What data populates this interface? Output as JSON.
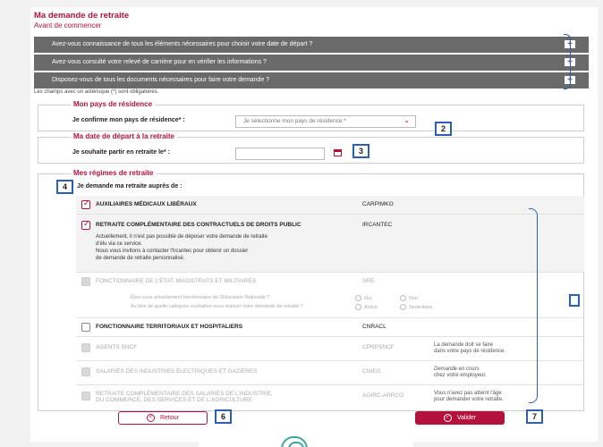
{
  "header": {
    "title": "Ma demande de retraite",
    "subtitle": "Avant de commencer"
  },
  "accordion": [
    {
      "label": "Avez-vous connaissance de tous les éléments nécessaires pour choisir votre date de départ ?",
      "icon": "plus-icon"
    },
    {
      "label": "Avez-vous consulté votre relevé de carrière pour en vérifier les informations ?",
      "icon": "plus-icon"
    },
    {
      "label": "Disposez-vous de tous les documents nécessaires pour faire votre demande ?",
      "icon": "plus-icon"
    }
  ],
  "mandatory_note": "Les champs avec un astérisque (*) sont obligatoires.",
  "residence": {
    "legend": "Mon pays de résidence",
    "label": "Je confirme mon pays de résidence* :",
    "select_value": "Je sélectionne mon pays de résidence *"
  },
  "departure": {
    "legend": "Ma date de départ à la retraite",
    "label": "Je souhaite partir en retraite le* :",
    "date_value": ""
  },
  "regimes": {
    "legend": "Mes régimes de retraite",
    "intro": "Je demande ma retraite auprès de :",
    "items": [
      {
        "name": "AUXILIAIRES MÉDICAUX LIBÉRAUX",
        "code": "CARPIMKO",
        "state": "checked"
      },
      {
        "name": "RETRAITE COMPLÉMENTAIRE DES CONTRACTUELS DE DROITS PUBLIC",
        "code": "IRCANTEC",
        "state": "checked",
        "info": [
          "Actuellement, il n'est pas possible de déposer votre demande de retraite",
          "d'élu via ce service.",
          "Nous vous invitons à contacter l'Ircantec pour obtenir un dossier",
          "de demande de retraite personnalisé."
        ]
      },
      {
        "name": "FONCTIONNAIRE DE L'ÉTAT, MAGISTRATS ET MILITAIRES",
        "code": "SRE",
        "state": "disabled"
      },
      {
        "name": "FONCTIONNAIRE TERRITORIAUX ET HOSPITALIERS",
        "code": "CNRACL",
        "state": "unchecked"
      },
      {
        "name": "AGENTS SNCF",
        "code": "CPRPSNCF",
        "state": "disabled",
        "note": [
          "La demande doit se faire",
          "dans votre pays de résidence."
        ]
      },
      {
        "name": "SALARIÉS DES INDUSTRIES ÉLECTRIQUES ET GAZIÈRES",
        "code": "CNIEG",
        "state": "disabled",
        "note": [
          "Demande en cours",
          "chez votre employeur."
        ]
      },
      {
        "name": "RETRAITE COMPLÉMENTAIRE DES SALARIÉS DE L'INDUSTRIE,",
        "name2": "DU COMMERCE, DES SERVICES ET DE L'AGRICULTURE",
        "code": "AGIRC-ARRCO",
        "state": "disabled",
        "note": [
          "Vous n'avez pas atteint l'âge",
          "pour demander votre retraite."
        ]
      }
    ],
    "sre_questions": [
      {
        "text": "Êtes-vous actuellement fonctionnaire de l'Éducation Nationale ?",
        "options": [
          "Oui",
          "Non"
        ]
      },
      {
        "text": "Au titre de quelle catégorie souhaitez-vous réaliser votre demande de retraite ?",
        "options": [
          "Active",
          "Sédentaire"
        ]
      }
    ]
  },
  "buttons": {
    "back": "Retour",
    "submit": "Valider"
  },
  "callouts": [
    "2",
    "3",
    "4",
    "6",
    "7"
  ],
  "colors": {
    "accent": "#b3123c",
    "callout_border": "#2c5fb0",
    "accordion_bg": "#6a6a6a"
  }
}
